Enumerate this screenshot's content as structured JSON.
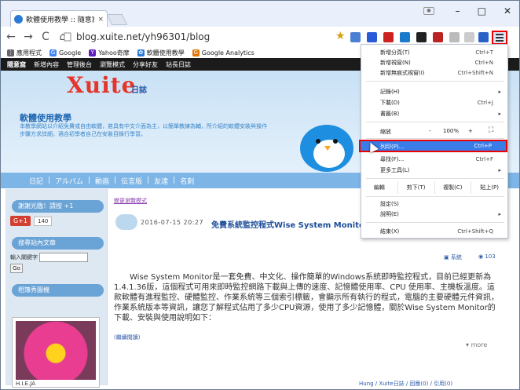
{
  "browser": {
    "tab_title": "軟體使用教學 :: 隨意窩 Xu",
    "tab_close": "×",
    "window_controls": {
      "minimize": "–",
      "maximize": "□",
      "close": "✕"
    },
    "url": "blog.xuite.net/yh96301/blog",
    "nav": {
      "back": "←",
      "forward": "→",
      "reload": "C",
      "home": "⌂"
    }
  },
  "bookmarks": [
    {
      "label": "應用程式",
      "icon": "apps-icon",
      "color": "#666"
    },
    {
      "label": "Google",
      "icon": "google-icon",
      "color": "#4285f4"
    },
    {
      "label": "Yahoo奇摩",
      "icon": "yahoo-icon",
      "color": "#5f1ebe"
    },
    {
      "label": "軟體使用教學",
      "icon": "xuite-icon",
      "color": "#2a7ad6"
    },
    {
      "label": "Google Analytics",
      "icon": "analytics-icon",
      "color": "#e37400"
    }
  ],
  "site": {
    "brand": "隨意窩",
    "links": [
      "新增內容",
      "管理後台",
      "瀏覽模式",
      "分享好友",
      "站長日誌"
    ],
    "logo": "Xuite",
    "logo_sub": "日誌",
    "blog_title": "軟體使用教學",
    "blog_desc": "本教學網站以介紹免費或自由軟體，甚具有中文介面為主，以簡單教練為輔，所介紹的軟體安裝與操作步驟方求詳細，適合初學者自己在安裝目錄行學習。",
    "nav": [
      "日記",
      "|",
      "アルバム",
      "|",
      "動画",
      "|",
      "伝言版",
      "|",
      "友達",
      "|",
      "名刺"
    ]
  },
  "sidebar": {
    "thanks_title": "謝謝光臨！請按 +1",
    "gplus_label": "G+1",
    "gplus_count": "140",
    "search_title": "搜尋站內文章",
    "search_label": "輸入關鍵字",
    "search_button": "Go",
    "gallery_title": "相簿秀圖機",
    "gallery_caption": "H.I.E.JA"
  },
  "post": {
    "breadcrumb": "變更瀏覽模式",
    "date": "2016-07-15 20:27",
    "title": "免費系統監控程式Wise System Monitor",
    "category": "系統",
    "views": "103",
    "body": "Wise System Monitor是一套免費、中文化、操作簡單的Windows系統即時監控程式，目前已經更新為1.4.1.36版，這個程式可用來即時監控網路下載與上傳的速度、記憶體使用率、CPU 使用率、主機板溫度。這款軟體有進程監控、硬體監控、作業系統等三個索引標籤，會顯示所有執行的程式，電腦的主要硬體元件資訊，作業系統版本等資訊，讓您了解程式佔用了多少CPU資源，使用了多少記憶體，關於Wise System Monitor的下載、安裝與使用說明如下：",
    "read_more": "(繼續閱讀)",
    "more": "more",
    "footer": "Hung / Xuite日誌 / 回應(0) / 引用(0)"
  },
  "menu": {
    "items": [
      {
        "label": "新增分頁(T)",
        "shortcut": "Ctrl+T"
      },
      {
        "label": "新增視窗(N)",
        "shortcut": "Ctrl+N"
      },
      {
        "label": "新增無痕式視窗(I)",
        "shortcut": "Ctrl+Shift+N"
      },
      {
        "label": "記錄(H)",
        "shortcut": "▸"
      },
      {
        "label": "下載(D)",
        "shortcut": "Ctrl+J"
      },
      {
        "label": "書籤(B)",
        "shortcut": "▸"
      }
    ],
    "zoom_label": "縮放",
    "zoom_minus": "-",
    "zoom_value": "100%",
    "zoom_plus": "+",
    "fullscreen": "⛶",
    "print_label": "列印(P)...",
    "print_shortcut": "Ctrl+P",
    "find_label": "尋找(F)...",
    "find_shortcut": "Ctrl+F",
    "tools_label": "更多工具(L)",
    "edit_label": "編輯",
    "cut": "剪下(T)",
    "copy": "複製(C)",
    "paste": "貼上(P)",
    "settings": "設定(S)",
    "help": "說明(E)",
    "exit_label": "結束(X)",
    "exit_shortcut": "Ctrl+Shift+Q"
  }
}
